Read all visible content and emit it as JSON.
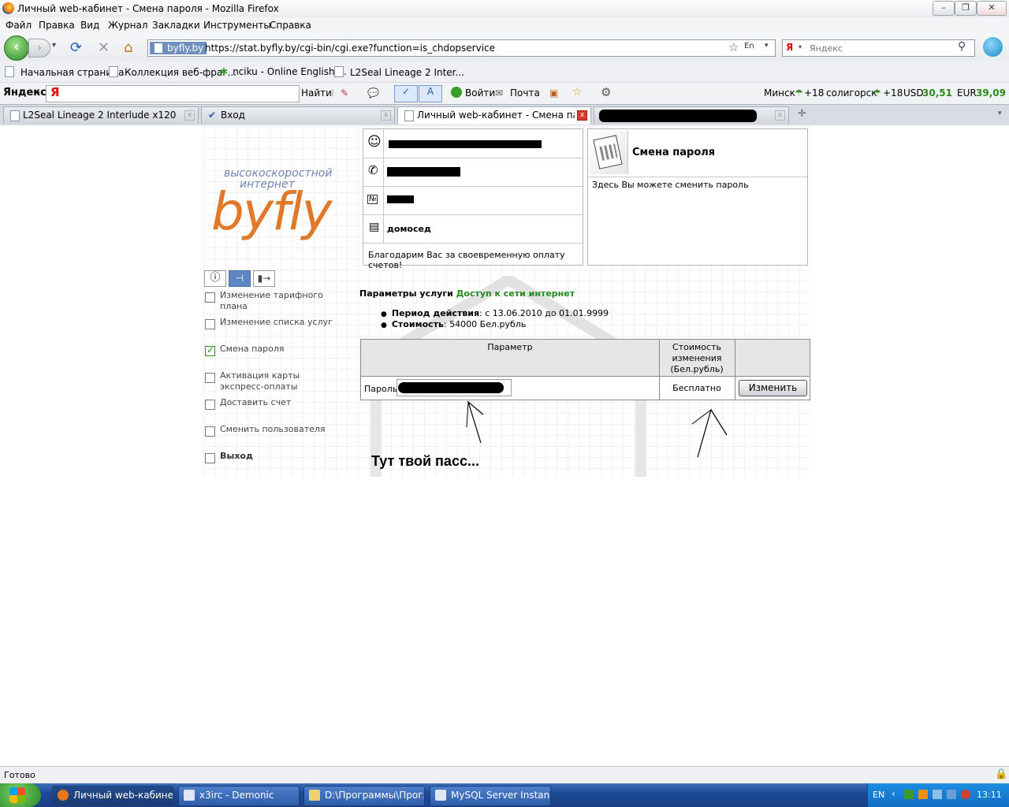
{
  "window": {
    "title": "Личный web-кабинет - Смена пароля - Mozilla Firefox"
  },
  "menu": [
    "Файл",
    "Правка",
    "Вид",
    "Журнал",
    "Закладки",
    "Инструменты",
    "Справка"
  ],
  "nav": {
    "site_badge": "byfly.by",
    "url": "https://stat.byfly.by/cgi-bin/cgi.exe?function=is_chdopservice",
    "search_placeholder": "Яндекс"
  },
  "bookmarks": [
    "Начальная страница",
    "Коллекция веб-фраг...",
    "nciku - Online English ...",
    "L2Seal Lineage 2 Inter..."
  ],
  "yandex_bar": {
    "logo": "Яндекс",
    "find_button": "Найти",
    "login": "Войти",
    "mail": "Почта",
    "city1": "Минск",
    "temp1": "+18",
    "city2": "солигорск",
    "temp2": "+18",
    "usd_label": "USD",
    "usd_value": "30,51",
    "eur_label": "EUR",
    "eur_value": "39,09"
  },
  "tabs": [
    {
      "label": "L2Seal Lineage 2 Interlude x1200"
    },
    {
      "label": "Вход"
    },
    {
      "label": "Личный web-кабинет - Смена па..."
    },
    {
      "label": ""
    }
  ],
  "page": {
    "logo_tagline_1": "высокоскоростной",
    "logo_tagline_2": "интернет",
    "logo_brand": "byfly",
    "tariff": "домосед",
    "thanks": "Благодарим Вас за своевременную оплату счетов!",
    "panel_title": "Смена пароля",
    "panel_desc": "Здесь Вы можете сменить пароль",
    "sidebar": [
      {
        "label": "Изменение тарифного плана",
        "checked": false
      },
      {
        "label": "Изменение списка услуг",
        "checked": false
      },
      {
        "label": "Смена пароля",
        "checked": true
      },
      {
        "label": "Активация карты экспресс-оплаты",
        "checked": false
      },
      {
        "label": "Доставить счет",
        "checked": false
      },
      {
        "label": "Сменить пользователя",
        "checked": false
      },
      {
        "label": "Выход",
        "checked": false
      }
    ],
    "service_params_label": "Параметры услуги",
    "service_name": "Доступ к сети интернет",
    "period_label": "Период действия",
    "period_value": ": с 13.06.2010 до 01.01.9999",
    "cost_label": "Стоимость",
    "cost_value": ": 54000 Бел.рубль",
    "table": {
      "col_param": "Параметр",
      "col_cost": "Стоимость изменения (Бел.рубль)",
      "row_label": "Пароль",
      "row_cost": "Бесплатно",
      "button": "Изменить"
    },
    "annotation": "Тут твой пасс..."
  },
  "status": {
    "text": "Готово"
  },
  "taskbar": {
    "items": [
      "Личный web-кабине...",
      "x3irc - Demonic",
      "D:\\Программы\\Прог...",
      "MySQL Server Instan..."
    ],
    "lang": "EN",
    "clock": "13:11"
  }
}
